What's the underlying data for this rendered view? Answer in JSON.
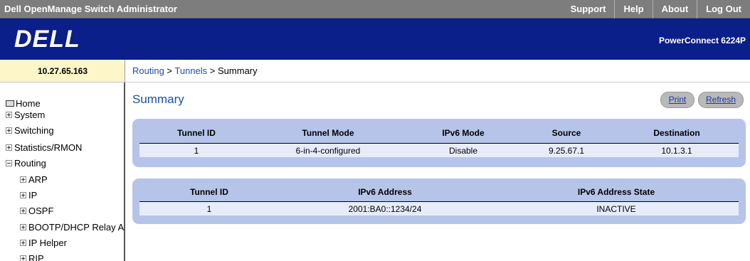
{
  "app_title": "Dell OpenManage Switch Administrator",
  "top_links": [
    "Support",
    "Help",
    "About",
    "Log Out"
  ],
  "brand": {
    "logo": "DELL",
    "model": "PowerConnect 6224P"
  },
  "ip_address": "10.27.65.163",
  "breadcrumb": {
    "part1": "Routing",
    "sep1": " > ",
    "part2": "Tunnels",
    "sep2": " > ",
    "current": "Summary"
  },
  "sidebar": {
    "items": [
      {
        "label": "Home",
        "icon": "home-icon"
      },
      {
        "label": "System",
        "icon": "plus-expander-icon"
      },
      {
        "label": "Switching",
        "icon": "plus-expander-icon"
      },
      {
        "label": "Statistics/RMON",
        "icon": "plus-expander-icon"
      },
      {
        "label": "Routing",
        "icon": "minus-expander-icon"
      },
      {
        "label": "ARP",
        "icon": "plus-expander-icon"
      },
      {
        "label": "IP",
        "icon": "plus-expander-icon"
      },
      {
        "label": "OSPF",
        "icon": "plus-expander-icon"
      },
      {
        "label": "BOOTP/DHCP Relay A",
        "icon": "plus-expander-icon"
      },
      {
        "label": "IP Helper",
        "icon": "plus-expander-icon"
      },
      {
        "label": "RIP",
        "icon": "plus-expander-icon"
      }
    ]
  },
  "page_title": "Summary",
  "buttons": {
    "print": "Print",
    "refresh": "Refresh"
  },
  "tunnel_table": {
    "headers": [
      "Tunnel ID",
      "Tunnel Mode",
      "IPv6 Mode",
      "Source",
      "Destination"
    ],
    "rows": [
      [
        "1",
        "6-in-4-configured",
        "Disable",
        "9.25.67.1",
        "10.1.3.1"
      ]
    ]
  },
  "address_table": {
    "headers": [
      "Tunnel ID",
      "IPv6 Address",
      "IPv6 Address State"
    ],
    "rows": [
      [
        "1",
        "2001:BA0::1234/24",
        "INACTIVE"
      ]
    ]
  },
  "colors": {
    "topbar": "#7d7d7d",
    "brandbar": "#0a1f8a",
    "panel": "#b6c4ea",
    "link": "#1a4fae"
  }
}
